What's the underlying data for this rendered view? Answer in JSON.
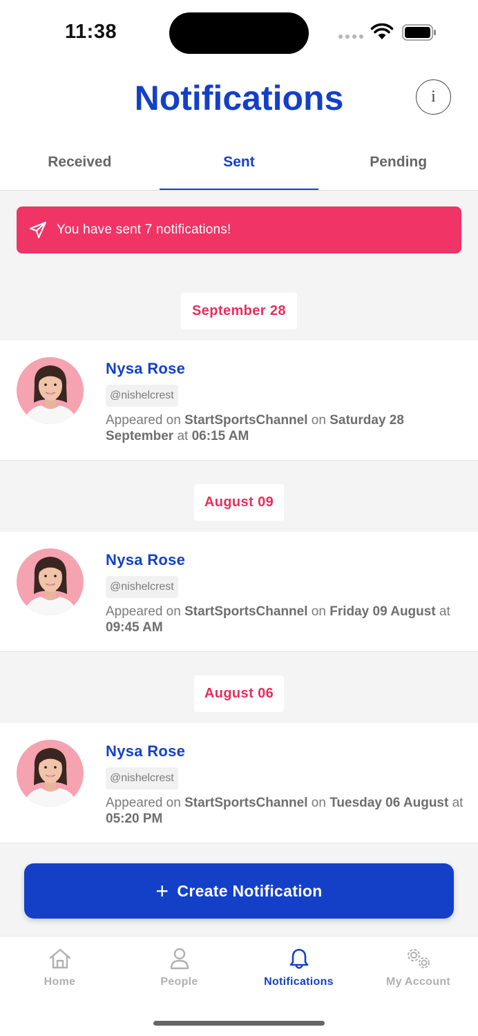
{
  "status_bar": {
    "time": "11:38"
  },
  "header": {
    "title": "Notifications",
    "info_icon": "i"
  },
  "tabs": [
    {
      "label": "Received",
      "active": false
    },
    {
      "label": "Sent",
      "active": true
    },
    {
      "label": "Pending",
      "active": false
    }
  ],
  "banner": {
    "text": "You have sent 7 notifications!",
    "icon": "paper-plane-icon",
    "color": "#f03466"
  },
  "groups": [
    {
      "date": "September 28",
      "item": {
        "name": "Nysa Rose",
        "handle": "@nishelcrest",
        "prefix": "Appeared on ",
        "channel": "StartSportsChannel",
        "mid": " on ",
        "day": "Saturday 28 September",
        "at": " at ",
        "time": "06:15 AM"
      }
    },
    {
      "date": "August 09",
      "item": {
        "name": "Nysa Rose",
        "handle": "@nishelcrest",
        "prefix": "Appeared on ",
        "channel": "StartSportsChannel",
        "mid": " on ",
        "day": "Friday 09 August",
        "at": " at ",
        "time": "09:45 AM"
      }
    },
    {
      "date": "August 06",
      "item": {
        "name": "Nysa Rose",
        "handle": "@nishelcrest",
        "prefix": "Appeared on ",
        "channel": "StartSportsChannel",
        "mid": " on ",
        "day": "Tuesday 06 August",
        "at": " at ",
        "time": "05:20 PM"
      }
    }
  ],
  "create_button": {
    "icon": "+",
    "label": "Create Notification"
  },
  "bottom_nav": [
    {
      "label": "Home",
      "icon": "home-icon",
      "active": false
    },
    {
      "label": "People",
      "icon": "person-icon",
      "active": false
    },
    {
      "label": "Notifications",
      "icon": "bell-icon",
      "active": true
    },
    {
      "label": "My Account",
      "icon": "gears-icon",
      "active": false
    }
  ],
  "colors": {
    "brand_blue": "#1440c8",
    "accent_pink": "#ea2d5e"
  }
}
